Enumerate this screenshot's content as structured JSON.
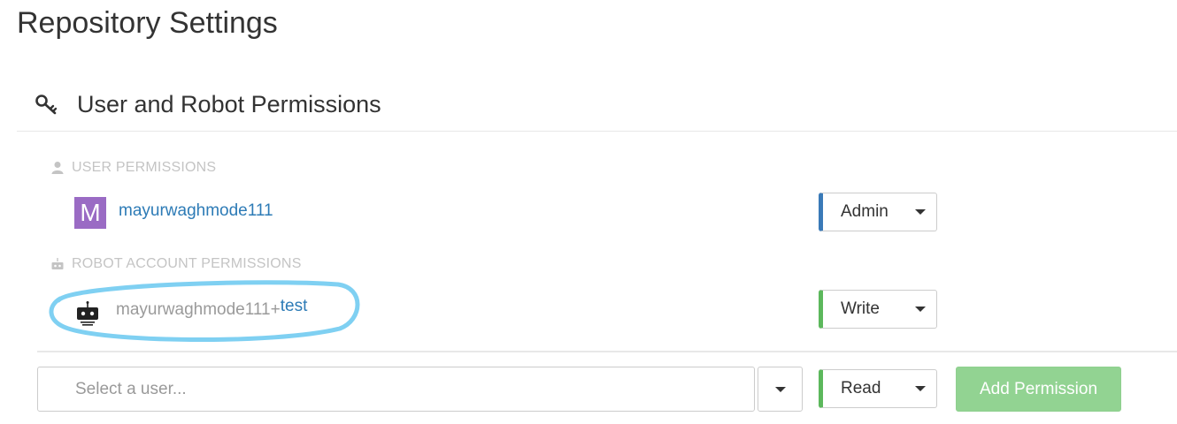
{
  "page": {
    "title": "Repository Settings"
  },
  "section": {
    "icon": "key-icon",
    "title": "User and Robot Permissions"
  },
  "user_permissions": {
    "label": "USER PERMISSIONS",
    "icon": "user-icon",
    "entries": [
      {
        "avatar_letter": "M",
        "avatar_color": "#9a6bc4",
        "name": "mayurwaghmode111",
        "role": "Admin",
        "role_color": "#3a7ab8"
      }
    ]
  },
  "robot_permissions": {
    "label": "ROBOT ACCOUNT PERMISSIONS",
    "icon": "robot-icon",
    "entries": [
      {
        "name_prefix": "mayurwaghmode111+",
        "name_suffix": "test",
        "role": "Write",
        "role_color": "#5cb85c",
        "highlighted": true
      }
    ]
  },
  "add_permission": {
    "user_placeholder": "Select a user...",
    "role": "Read",
    "role_color": "#5cb85c",
    "button_label": "Add Permission",
    "button_color": "#92d392"
  }
}
